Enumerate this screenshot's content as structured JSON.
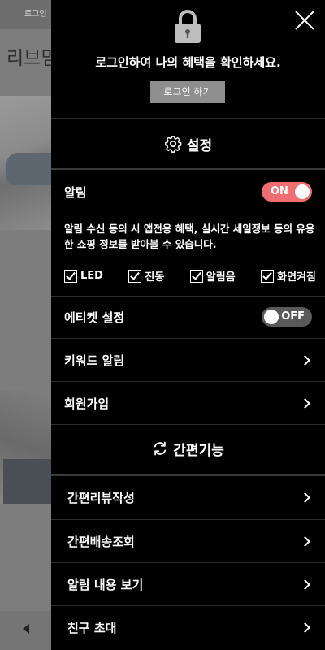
{
  "background": {
    "topbar_text": "로그인",
    "title_text": "리브믿"
  },
  "drawer": {
    "login": {
      "message": "로그인하여 나의 혜택을 확인하세요.",
      "button_label": "로그인 하기"
    },
    "settings": {
      "title": "설정",
      "alarm": {
        "label": "알림",
        "toggle": "ON",
        "description": "알림 수신 동의 시 앱전용 혜택, 실시간 세일정보 등의 유용한 쇼핑 정보를 받아볼 수 있습니다.",
        "options": [
          {
            "label": "LED",
            "checked": true
          },
          {
            "label": "진동",
            "checked": true
          },
          {
            "label": "알림음",
            "checked": true
          },
          {
            "label": "화면켜짐",
            "checked": true
          }
        ]
      },
      "etiquette": {
        "label": "에티켓 설정",
        "toggle": "OFF"
      },
      "keyword_alarm": "키워드 알림",
      "signup": "회원가입"
    },
    "quick": {
      "title": "간편기능",
      "items": [
        "간편리뷰작성",
        "간편배송조회",
        "알림 내용 보기",
        "친구 초대"
      ]
    }
  },
  "colors": {
    "toggle_on": "#f06e72",
    "toggle_off": "#5a5a5a",
    "login_button": "#8e8e8e"
  }
}
